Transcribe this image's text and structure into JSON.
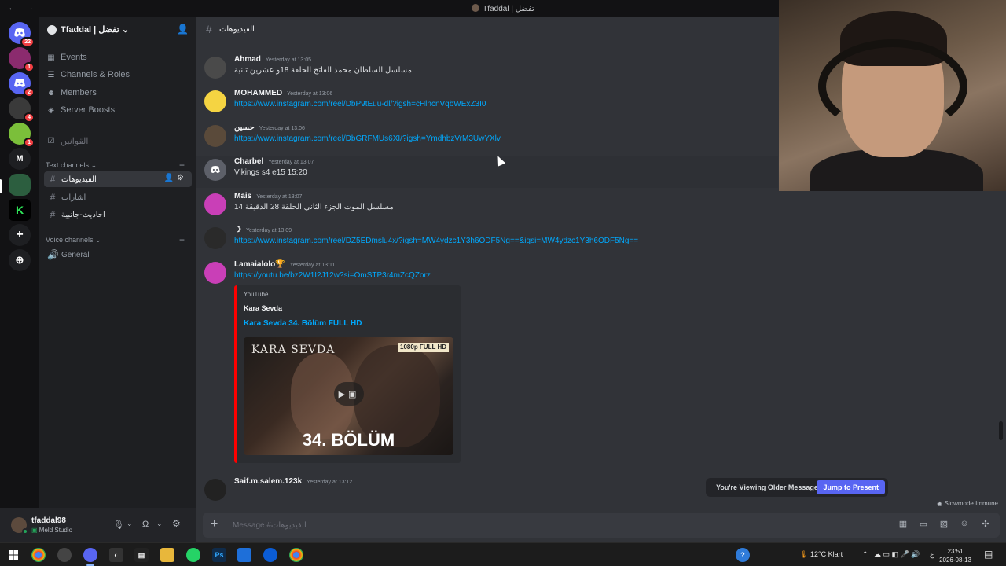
{
  "titlebar": {
    "back": "←",
    "forward": "→",
    "title": "Tfaddal | تفضل"
  },
  "servers": [
    {
      "icon": "discord-icon",
      "badge": "22"
    },
    {
      "icon": "server-icon",
      "badge": "1"
    },
    {
      "icon": "discord-icon",
      "badge": "2"
    },
    {
      "icon": "server-icon",
      "badge": "4"
    },
    {
      "icon": "server-icon",
      "badge": "1"
    },
    {
      "icon": "text",
      "label": "M"
    },
    {
      "icon": "server-icon"
    },
    {
      "icon": "text",
      "label": "K"
    },
    {
      "icon": "add-icon",
      "label": "+"
    },
    {
      "icon": "compass-icon",
      "label": "⊕"
    }
  ],
  "guild": {
    "name": "Tfaddal | تفضل"
  },
  "menu": {
    "events": "Events",
    "channels_roles": "Channels & Roles",
    "members": "Members",
    "server_boosts": "Server Boosts",
    "rules": "القوانين"
  },
  "categories": {
    "text": "Text channels",
    "voice": "Voice channels"
  },
  "text_channels": [
    "الفيديوهات",
    "اشارات",
    "احاديث-جانبية"
  ],
  "voice_channels": [
    "General"
  ],
  "chat": {
    "channel_name": "الفيديوهات"
  },
  "messages": [
    {
      "author": "Ahmad",
      "time": "Yesterday at 13:05",
      "text": "مسلسل السلطان محمد الفاتح الحلقة 18و عشرين ثانية",
      "color": "#4a4a4a"
    },
    {
      "author": "MOHAMMED",
      "time": "Yesterday at 13:06",
      "link": "https://www.instagram.com/reel/DbP9tEuu-dl/?igsh=cHlncnVqbWExZ3I0",
      "color": "#f5d442"
    },
    {
      "author": "حسين",
      "time": "Yesterday at 13:06",
      "link": "https://www.instagram.com/reel/DbGRFMUs6XI/?igsh=YmdhbzVrM3UwYXlv",
      "color": "#5a4a3a"
    },
    {
      "author": "Charbel",
      "time": "Yesterday at 13:07",
      "text": "Vikings s4 e15 15:20",
      "color": "#5d6069"
    },
    {
      "author": "Mais",
      "time": "Yesterday at 13:07",
      "text": "مسلسل الموت الجزء الثاني الحلقة 28 الدقيقة 14",
      "color": "#c93fb7"
    },
    {
      "author": "☽",
      "time": "Yesterday at 13:09",
      "link": "https://www.instagram.com/reel/DZ5EDmslu4x/?igsh=MW4ydzc1Y3h6ODF5Ng==&igsi=MW4ydzc1Y3h6ODF5Ng==",
      "color": "#2a2a2a"
    },
    {
      "author": "Lamaialolo🏆",
      "time": "Yesterday at 13:11",
      "link": "https://youtu.be/bz2W1I2J12w?si=OmSTP3r4mZcQZorz",
      "color": "#c93fb7"
    },
    {
      "author": "Saif.m.salem.123k",
      "time": "Yesterday at 13:12",
      "color": "#222"
    }
  ],
  "embed": {
    "provider": "YouTube",
    "author": "Kara Sevda",
    "title": "Kara Sevda 34. Bölüm FULL HD",
    "thumb_brand": "KARA SEVDA",
    "thumb_hd": "1080p FULL HD",
    "thumb_episode": "34. BÖLÜM"
  },
  "older_bar": {
    "label": "You're Viewing Older Messages",
    "jump": "Jump to Present"
  },
  "slowmode": "Slowmode Immune",
  "composer": {
    "placeholder": "Message #الفيديوهات"
  },
  "user": {
    "name": "tfaddal98",
    "status": "Meld Studio"
  },
  "taskbar": {
    "weather": "12°C  Klart",
    "time": "23:51",
    "date": "2026-08-13",
    "lang": "ع"
  },
  "colors": {
    "accent": "#5865f2",
    "link": "#00a8fc",
    "online": "#23a55a",
    "badge": "#f23f43"
  }
}
